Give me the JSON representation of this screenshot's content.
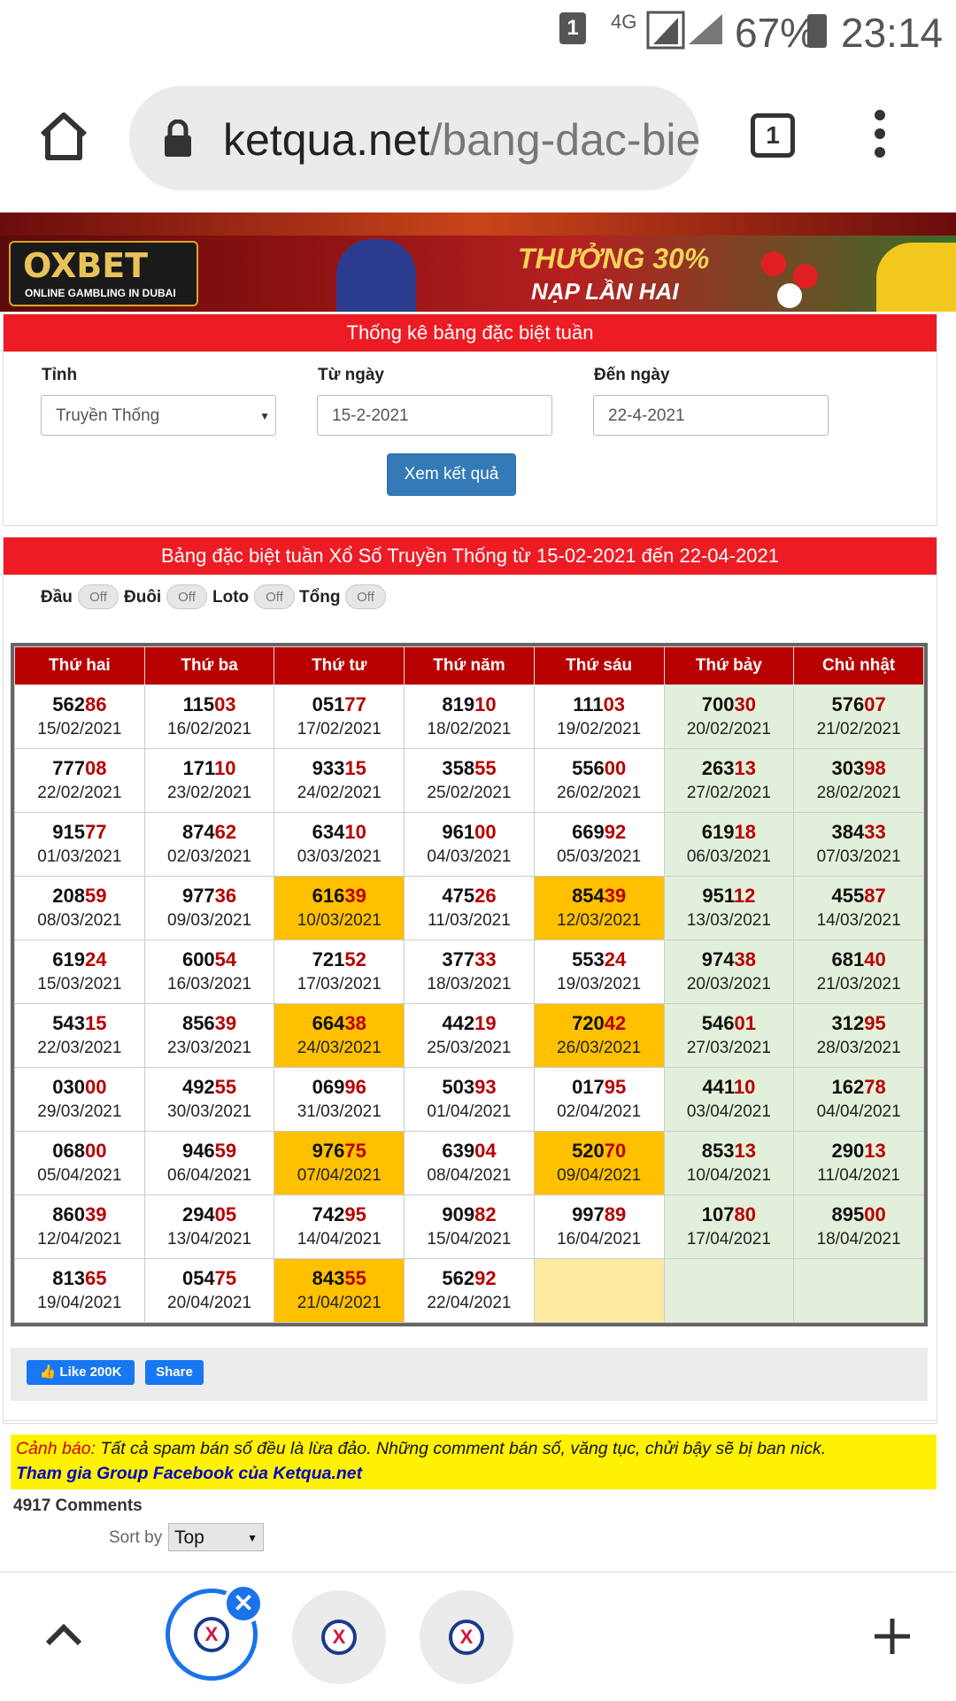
{
  "status_bar": {
    "notification_count": "1",
    "network": "4G",
    "battery": "67%",
    "time": "23:14"
  },
  "browser": {
    "url_host": "ketqua.net",
    "url_path": "/bang-dac-bie",
    "tab_count": "1"
  },
  "banner": {
    "brand": "OXBET",
    "tagline": "ONLINE GAMBLING IN DUBAI",
    "promo_line1": "THƯỞNG 30%",
    "promo_line2": "NẠP LẦN HAI"
  },
  "filter": {
    "title": "Thống kê bảng đặc biệt tuần",
    "province_label": "Tỉnh",
    "province_value": "Truyền Thống",
    "from_label": "Từ ngày",
    "from_value": "15-2-2021",
    "to_label": "Đến ngày",
    "to_value": "22-4-2021",
    "submit_label": "Xem kết quả"
  },
  "results": {
    "title": "Bảng đặc biệt tuần Xổ Số Truyền Thống từ 15-02-2021 đến 22-04-2021",
    "toggles": [
      {
        "label": "Đầu",
        "state": "Off"
      },
      {
        "label": "Đuôi",
        "state": "Off"
      },
      {
        "label": "Loto",
        "state": "Off"
      },
      {
        "label": "Tổng",
        "state": "Off"
      }
    ],
    "headers": [
      "Thứ hai",
      "Thứ ba",
      "Thứ tư",
      "Thứ năm",
      "Thứ sáu",
      "Thứ bảy",
      "Chủ nhật"
    ],
    "rows": [
      [
        {
          "n": "56286",
          "d": "15/02/2021"
        },
        {
          "n": "11503",
          "d": "16/02/2021"
        },
        {
          "n": "05177",
          "d": "17/02/2021"
        },
        {
          "n": "81910",
          "d": "18/02/2021"
        },
        {
          "n": "11103",
          "d": "19/02/2021"
        },
        {
          "n": "70030",
          "d": "20/02/2021"
        },
        {
          "n": "57607",
          "d": "21/02/2021"
        }
      ],
      [
        {
          "n": "77708",
          "d": "22/02/2021"
        },
        {
          "n": "17110",
          "d": "23/02/2021"
        },
        {
          "n": "93315",
          "d": "24/02/2021"
        },
        {
          "n": "35855",
          "d": "25/02/2021"
        },
        {
          "n": "55600",
          "d": "26/02/2021"
        },
        {
          "n": "26313",
          "d": "27/02/2021"
        },
        {
          "n": "30398",
          "d": "28/02/2021"
        }
      ],
      [
        {
          "n": "91577",
          "d": "01/03/2021"
        },
        {
          "n": "87462",
          "d": "02/03/2021"
        },
        {
          "n": "63410",
          "d": "03/03/2021"
        },
        {
          "n": "96100",
          "d": "04/03/2021"
        },
        {
          "n": "66992",
          "d": "05/03/2021"
        },
        {
          "n": "61918",
          "d": "06/03/2021"
        },
        {
          "n": "38433",
          "d": "07/03/2021"
        }
      ],
      [
        {
          "n": "20859",
          "d": "08/03/2021"
        },
        {
          "n": "97736",
          "d": "09/03/2021"
        },
        {
          "n": "61639",
          "d": "10/03/2021",
          "hl": true
        },
        {
          "n": "47526",
          "d": "11/03/2021"
        },
        {
          "n": "85439",
          "d": "12/03/2021",
          "hl": true
        },
        {
          "n": "95112",
          "d": "13/03/2021"
        },
        {
          "n": "45587",
          "d": "14/03/2021"
        }
      ],
      [
        {
          "n": "61924",
          "d": "15/03/2021"
        },
        {
          "n": "60054",
          "d": "16/03/2021"
        },
        {
          "n": "72152",
          "d": "17/03/2021"
        },
        {
          "n": "37733",
          "d": "18/03/2021"
        },
        {
          "n": "55324",
          "d": "19/03/2021"
        },
        {
          "n": "97438",
          "d": "20/03/2021"
        },
        {
          "n": "68140",
          "d": "21/03/2021"
        }
      ],
      [
        {
          "n": "54315",
          "d": "22/03/2021"
        },
        {
          "n": "85639",
          "d": "23/03/2021"
        },
        {
          "n": "66438",
          "d": "24/03/2021",
          "hl": true
        },
        {
          "n": "44219",
          "d": "25/03/2021"
        },
        {
          "n": "72042",
          "d": "26/03/2021",
          "hl": true
        },
        {
          "n": "54601",
          "d": "27/03/2021"
        },
        {
          "n": "31295",
          "d": "28/03/2021"
        }
      ],
      [
        {
          "n": "03000",
          "d": "29/03/2021"
        },
        {
          "n": "49255",
          "d": "30/03/2021"
        },
        {
          "n": "06996",
          "d": "31/03/2021"
        },
        {
          "n": "50393",
          "d": "01/04/2021"
        },
        {
          "n": "01795",
          "d": "02/04/2021"
        },
        {
          "n": "44110",
          "d": "03/04/2021"
        },
        {
          "n": "16278",
          "d": "04/04/2021"
        }
      ],
      [
        {
          "n": "06800",
          "d": "05/04/2021"
        },
        {
          "n": "94659",
          "d": "06/04/2021"
        },
        {
          "n": "97675",
          "d": "07/04/2021",
          "hl": true
        },
        {
          "n": "63904",
          "d": "08/04/2021"
        },
        {
          "n": "52070",
          "d": "09/04/2021",
          "hl": true
        },
        {
          "n": "85313",
          "d": "10/04/2021"
        },
        {
          "n": "29013",
          "d": "11/04/2021"
        }
      ],
      [
        {
          "n": "86039",
          "d": "12/04/2021"
        },
        {
          "n": "29405",
          "d": "13/04/2021"
        },
        {
          "n": "74295",
          "d": "14/04/2021"
        },
        {
          "n": "90982",
          "d": "15/04/2021"
        },
        {
          "n": "99789",
          "d": "16/04/2021"
        },
        {
          "n": "10780",
          "d": "17/04/2021"
        },
        {
          "n": "89500",
          "d": "18/04/2021"
        }
      ],
      [
        {
          "n": "81365",
          "d": "19/04/2021"
        },
        {
          "n": "05475",
          "d": "20/04/2021"
        },
        {
          "n": "84355",
          "d": "21/04/2021",
          "hl": true
        },
        {
          "n": "56292",
          "d": "22/04/2021"
        },
        {
          "n": "",
          "d": ""
        },
        {
          "n": "",
          "d": ""
        },
        {
          "n": "",
          "d": ""
        }
      ]
    ]
  },
  "social": {
    "like_label": "Like 200K",
    "share_label": "Share"
  },
  "warning": {
    "prefix": "Cảnh báo:",
    "text": " Tất cả spam bán số đều là lừa đảo. Những comment bán số, văng tục, chửi bậy sẽ bị ban nick.",
    "group_link": "Tham gia Group Facebook của Ketqua.net"
  },
  "comments": {
    "count_label": "4917 Comments",
    "sort_label": "Sort by",
    "sort_value": "Top"
  },
  "colors": {
    "header_red": "#ed1c24",
    "table_header": "#b80000",
    "highlight": "#ffc000",
    "weekend": "#e2efda",
    "accent_blue": "#1a73e8"
  }
}
